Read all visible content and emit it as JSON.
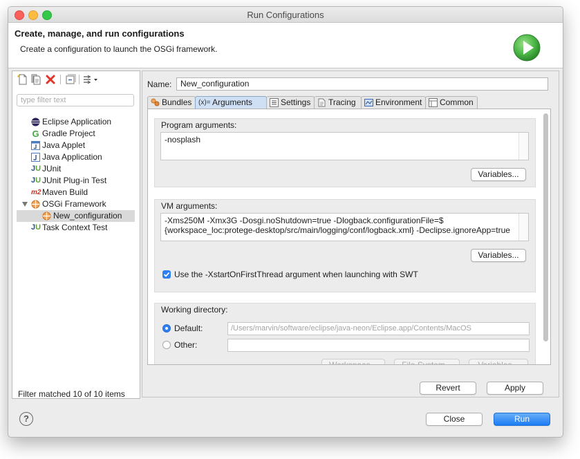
{
  "window": {
    "title": "Run Configurations"
  },
  "header": {
    "title": "Create, manage, and run configurations",
    "description": "Create a configuration to launch the OSGi framework."
  },
  "toolbar": {
    "icons": [
      "new-config-icon",
      "duplicate-config-icon",
      "delete-config-icon",
      "collapse-all-icon",
      "filter-config-icon"
    ]
  },
  "filter": {
    "placeholder": "type filter text",
    "status": "Filter matched 10 of 10 items"
  },
  "tree": {
    "items": [
      {
        "label": "Eclipse Application",
        "icon": "eclipse-icon"
      },
      {
        "label": "Gradle Project",
        "icon": "gradle-icon"
      },
      {
        "label": "Java Applet",
        "icon": "java-applet-icon"
      },
      {
        "label": "Java Application",
        "icon": "java-application-icon"
      },
      {
        "label": "JUnit",
        "icon": "junit-icon"
      },
      {
        "label": "JUnit Plug-in Test",
        "icon": "junit-plugin-icon"
      },
      {
        "label": "Maven Build",
        "icon": "maven-icon"
      },
      {
        "label": "OSGi Framework",
        "icon": "osgi-icon",
        "expanded": true
      },
      {
        "label": "New_configuration",
        "icon": "osgi-icon",
        "selected": true
      },
      {
        "label": "Task Context Test",
        "icon": "task-context-icon"
      }
    ]
  },
  "config": {
    "name_label": "Name:",
    "name_value": "New_configuration",
    "tabs": [
      {
        "label": "Bundles",
        "icon": "bundles-icon"
      },
      {
        "label": "Arguments",
        "icon": "arguments-icon",
        "active": true
      },
      {
        "label": "Settings",
        "icon": "settings-icon"
      },
      {
        "label": "Tracing",
        "icon": "tracing-icon"
      },
      {
        "label": "Environment",
        "icon": "environment-icon"
      },
      {
        "label": "Common",
        "icon": "common-icon"
      }
    ],
    "program_args": {
      "label": "Program arguments:",
      "value": "-nosplash",
      "variables_label": "Variables..."
    },
    "vm_args": {
      "label": "VM arguments:",
      "line1": "-Xms250M -Xmx3G -Dosgi.noShutdown=true -Dlogback.configurationFile=$",
      "line2": "{workspace_loc:protege-desktop/src/main/logging/conf/logback.xml} -Declipse.ignoreApp=true",
      "variables_label": "Variables...",
      "checkbox_label": "Use the -XstartOnFirstThread argument when launching with SWT",
      "checkbox_checked": true
    },
    "working_dir": {
      "label": "Working directory:",
      "default_label": "Default:",
      "default_value": "/Users/marvin/software/eclipse/java-neon/Eclipse.app/Contents/MacOS",
      "other_label": "Other:",
      "other_value": "",
      "workspace_label": "Workspace...",
      "filesystem_label": "File System...",
      "variables_label": "Variables..."
    },
    "revert_label": "Revert",
    "apply_label": "Apply"
  },
  "footer": {
    "help_symbol": "?",
    "close_label": "Close",
    "run_label": "Run"
  },
  "colors": {
    "accent": "#1c7cf4",
    "run_badge": "#4db848",
    "delete_icon": "#e0352b"
  }
}
